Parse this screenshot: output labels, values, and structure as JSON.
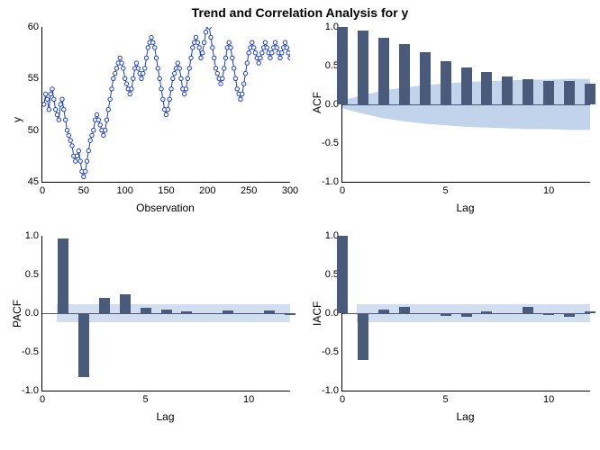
{
  "title": "Trend and Correlation Analysis for y",
  "panels": {
    "ts": {
      "ylabel": "y",
      "xlabel": "Observation"
    },
    "acf": {
      "ylabel": "ACF",
      "xlabel": "Lag"
    },
    "pacf": {
      "ylabel": "PACF",
      "xlabel": "Lag"
    },
    "iacf": {
      "ylabel": "IACF",
      "xlabel": "Lag"
    }
  },
  "ticks": {
    "ts_x": [
      "0",
      "50",
      "100",
      "150",
      "200",
      "250",
      "300"
    ],
    "ts_y": [
      "45",
      "50",
      "55",
      "60"
    ],
    "lag_x": [
      "0",
      "5",
      "10"
    ],
    "cf_y": [
      "-1.0",
      "-0.5",
      "0.0",
      "0.5",
      "1.0"
    ]
  },
  "chart_data": [
    {
      "type": "line",
      "id": "ts",
      "title": "",
      "xlabel": "Observation",
      "ylabel": "y",
      "xlim": [
        0,
        300
      ],
      "ylim": [
        45,
        60
      ],
      "n": 300,
      "note": "Dense time-series trace with ~300 observations; values oscillate between ~46 and ~60.5 with upward trend.",
      "x": [
        2,
        4,
        6,
        8,
        10,
        12,
        14,
        16,
        18,
        20,
        22,
        24,
        26,
        28,
        30,
        32,
        34,
        36,
        38,
        40,
        42,
        44,
        46,
        48,
        50,
        52,
        54,
        56,
        58,
        60,
        62,
        64,
        66,
        68,
        70,
        72,
        74,
        76,
        78,
        80,
        82,
        84,
        86,
        88,
        90,
        92,
        94,
        96,
        98,
        100,
        102,
        104,
        106,
        108,
        110,
        112,
        114,
        116,
        118,
        120,
        122,
        124,
        126,
        128,
        130,
        132,
        134,
        136,
        138,
        140,
        142,
        144,
        146,
        148,
        150,
        152,
        154,
        156,
        158,
        160,
        162,
        164,
        166,
        168,
        170,
        172,
        174,
        176,
        178,
        180,
        182,
        184,
        186,
        188,
        190,
        192,
        194,
        196,
        198,
        200,
        202,
        204,
        206,
        208,
        210,
        212,
        214,
        216,
        218,
        220,
        222,
        224,
        226,
        228,
        230,
        232,
        234,
        236,
        238,
        240,
        242,
        244,
        246,
        248,
        250,
        252,
        254,
        256,
        258,
        260,
        262,
        264,
        266,
        268,
        270,
        272,
        274,
        276,
        278,
        280,
        282,
        284,
        286,
        288,
        290,
        292,
        294,
        296,
        298,
        300
      ],
      "y": [
        52.5,
        53.5,
        53.0,
        52.0,
        53.5,
        54.0,
        53.0,
        52.0,
        51.5,
        51.0,
        52.5,
        53.0,
        52.0,
        51.0,
        50.0,
        49.5,
        49.0,
        48.5,
        47.5,
        47.0,
        47.5,
        48.0,
        47.0,
        46.0,
        45.5,
        46.0,
        47.0,
        48.0,
        49.0,
        49.5,
        50.0,
        51.0,
        51.5,
        51.0,
        50.5,
        50.0,
        49.5,
        50.0,
        51.0,
        52.0,
        53.0,
        54.0,
        55.0,
        55.5,
        56.0,
        56.5,
        57.0,
        56.5,
        56.0,
        55.0,
        54.5,
        54.0,
        53.5,
        54.0,
        55.0,
        56.0,
        56.5,
        56.0,
        55.5,
        55.0,
        55.5,
        56.0,
        57.0,
        58.0,
        58.5,
        59.0,
        58.5,
        58.0,
        57.0,
        56.0,
        55.0,
        54.0,
        53.0,
        52.0,
        51.5,
        52.0,
        53.0,
        54.0,
        55.0,
        55.5,
        56.0,
        56.5,
        56.0,
        55.0,
        54.0,
        53.5,
        54.0,
        55.0,
        56.0,
        57.0,
        58.0,
        58.5,
        59.0,
        58.5,
        58.0,
        57.0,
        57.5,
        58.5,
        59.5,
        60.5,
        60.0,
        59.0,
        58.0,
        57.0,
        56.0,
        55.5,
        55.0,
        54.5,
        55.0,
        56.0,
        57.0,
        58.0,
        58.5,
        58.0,
        57.0,
        56.0,
        55.0,
        54.0,
        53.5,
        53.0,
        53.5,
        54.5,
        55.5,
        56.5,
        57.5,
        58.0,
        58.5,
        58.0,
        57.5,
        57.0,
        56.5,
        57.0,
        57.5,
        58.0,
        58.5,
        58.0,
        57.5,
        57.0,
        57.5,
        58.0,
        58.5,
        58.0,
        57.5,
        57.0,
        57.5,
        58.0,
        58.5,
        58.0,
        57.5,
        57.0
      ]
    },
    {
      "type": "bar",
      "id": "acf",
      "title": "",
      "xlabel": "Lag",
      "ylabel": "ACF",
      "xlim": [
        0,
        12
      ],
      "ylim": [
        -1.0,
        1.0
      ],
      "categories": [
        0,
        1,
        2,
        3,
        4,
        5,
        6,
        7,
        8,
        9,
        10,
        11,
        12
      ],
      "values": [
        1.0,
        0.95,
        0.86,
        0.78,
        0.67,
        0.56,
        0.48,
        0.42,
        0.36,
        0.32,
        0.3,
        0.3,
        0.27
      ],
      "ci_upper": [
        0.05,
        0.12,
        0.18,
        0.22,
        0.25,
        0.27,
        0.29,
        0.3,
        0.31,
        0.32,
        0.32,
        0.33,
        0.33
      ],
      "ci_lower": [
        -0.05,
        -0.12,
        -0.18,
        -0.22,
        -0.25,
        -0.27,
        -0.29,
        -0.3,
        -0.31,
        -0.32,
        -0.32,
        -0.33,
        -0.33
      ]
    },
    {
      "type": "bar",
      "id": "pacf",
      "title": "",
      "xlabel": "Lag",
      "ylabel": "PACF",
      "xlim": [
        0,
        12
      ],
      "ylim": [
        -1.0,
        1.0
      ],
      "categories": [
        1,
        2,
        3,
        4,
        5,
        6,
        7,
        8,
        9,
        10,
        11,
        12
      ],
      "values": [
        0.97,
        -0.82,
        0.2,
        0.25,
        0.07,
        0.05,
        0.02,
        0.0,
        0.03,
        0.0,
        0.04,
        -0.02
      ],
      "ci_const": 0.12
    },
    {
      "type": "bar",
      "id": "iacf",
      "title": "",
      "xlabel": "Lag",
      "ylabel": "IACF",
      "xlim": [
        0,
        12
      ],
      "ylim": [
        -1.0,
        1.0
      ],
      "categories": [
        0,
        1,
        2,
        3,
        4,
        5,
        6,
        7,
        8,
        9,
        10,
        11,
        12
      ],
      "values": [
        1.0,
        -0.6,
        0.05,
        0.08,
        0.0,
        -0.04,
        -0.05,
        0.02,
        0.0,
        0.08,
        -0.02,
        -0.05,
        0.02
      ],
      "ci_const": 0.12
    }
  ]
}
